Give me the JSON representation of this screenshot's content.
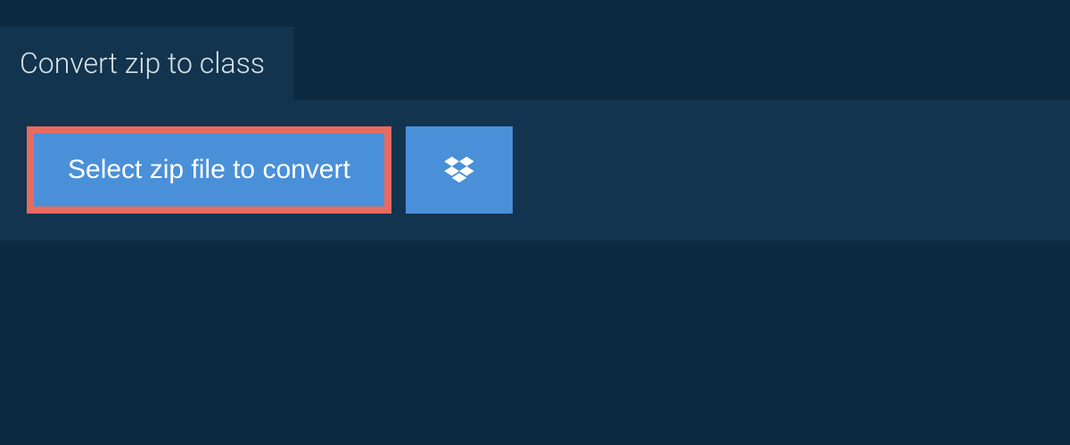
{
  "tab": {
    "label": "Convert zip to class"
  },
  "uploader": {
    "select_label": "Select zip file to convert",
    "dropbox_icon": "dropbox"
  },
  "colors": {
    "page_bg": "#0e2a40",
    "panel_bg": "#13344e",
    "button_bg": "#4a90d9",
    "highlight_border": "#e86b5f",
    "text_light": "#d7e2ea",
    "text_white": "#ffffff"
  }
}
